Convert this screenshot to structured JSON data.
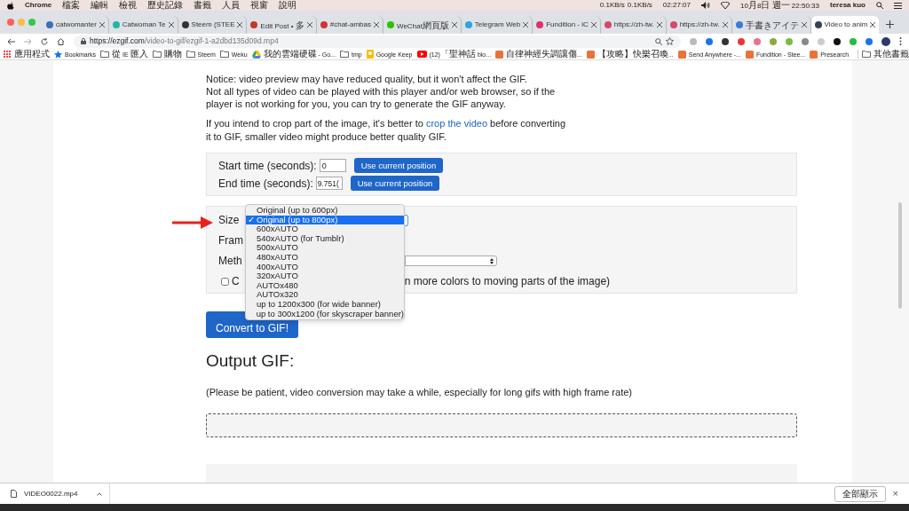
{
  "menubar": {
    "app": "Chrome",
    "items": [
      "檔案",
      "編輯",
      "檢視",
      "歷史記錄",
      "書籤",
      "人員",
      "視窗",
      "說明"
    ],
    "net_speed": [
      "0.1KB/s",
      "0.1KB/s"
    ],
    "timer": "02:27:07",
    "clock": "10月8日 週一 22:50:33",
    "user": "teresa kuo"
  },
  "tabs": [
    {
      "title": "catwomanter",
      "selected": false,
      "color": "#3b6fb6"
    },
    {
      "title": "Catwoman Te",
      "selected": false,
      "color": "#1fb8a8"
    },
    {
      "title": "Steem (STEE",
      "selected": false,
      "color": "#333333"
    },
    {
      "title": "Edit Post • 多",
      "selected": false,
      "color": "#c0392b"
    },
    {
      "title": "#chat-ambas",
      "selected": false,
      "color": "#d0343a"
    },
    {
      "title": "WeChat網頁版",
      "selected": false,
      "color": "#2dc100"
    },
    {
      "title": "Telegram Web",
      "selected": false,
      "color": "#2ca5e0"
    },
    {
      "title": "Fundition - iC",
      "selected": false,
      "color": "#e0306a"
    },
    {
      "title": "https://zh-tw.",
      "selected": false,
      "color": "#d04a6a"
    },
    {
      "title": "https://zh-tw.",
      "selected": false,
      "color": "#d04a6a"
    },
    {
      "title": "手書きアイテ",
      "selected": false,
      "color": "#3a7bd5"
    },
    {
      "title": "Video to anim",
      "selected": true,
      "color": "#334455"
    }
  ],
  "address": {
    "host": "https://ezgif.com",
    "path": "/video-to-gif/ezgif-1-a2dbd135d09d.mp4"
  },
  "bookmarks": [
    {
      "label": "應用程式",
      "kind": "apps"
    },
    {
      "label": "Bookmarks",
      "kind": "star"
    },
    {
      "label": "從 IE 匯入",
      "kind": "folder"
    },
    {
      "label": "購物",
      "kind": "folder"
    },
    {
      "label": "Steem",
      "kind": "folder"
    },
    {
      "label": "Weku",
      "kind": "folder"
    },
    {
      "label": "我的雲端硬碟 - Go...",
      "kind": "drive"
    },
    {
      "label": "tmp",
      "kind": "folder"
    },
    {
      "label": "Google Keep",
      "kind": "keep"
    },
    {
      "label": "(12)「聖神話 blo...",
      "kind": "video"
    },
    {
      "label": "自律神經失調讓傷...",
      "kind": "site"
    },
    {
      "label": "【攻略】快樂召喚...",
      "kind": "site"
    },
    {
      "label": "Send Anywhere -...",
      "kind": "site"
    },
    {
      "label": "Fundition - Stee...",
      "kind": "site"
    },
    {
      "label": "Presearch",
      "kind": "site"
    }
  ],
  "other_bookmarks": "其他書籤",
  "page": {
    "notice": "Notice: video preview may have reduced quality, but it won't affect the GIF.",
    "notice2": "Not all types of video can be played with this player and/or web browser, so if the player is not working for you, you can try to generate the GIF anyway.",
    "crop_before": "If you intend to crop part of the image, it's better to",
    "crop_link": "crop the video",
    "crop_after": "before converting it to GIF, smaller video might produce better quality GIF.",
    "start_label": "Start time (seconds):",
    "start_value": "0",
    "end_label": "End time (seconds):",
    "end_value": "9.751(",
    "position_button": "Use current position",
    "position_button2": "Use current position",
    "size_label": "Size",
    "frame_label": "Fram",
    "method_label": "Meth",
    "option_label_start": "C",
    "option_label_end": "n more colors to moving parts of the image)",
    "option_checked": false,
    "size_options": [
      {
        "label": "Original (up to 600px)",
        "selected": false
      },
      {
        "label": "Original (up to 800px)",
        "selected": true
      },
      {
        "label": "600xAUTO",
        "selected": false
      },
      {
        "label": "540xAUTO (for Tumblr)",
        "selected": false
      },
      {
        "label": "500xAUTO",
        "selected": false
      },
      {
        "label": "480xAUTO",
        "selected": false
      },
      {
        "label": "400xAUTO",
        "selected": false
      },
      {
        "label": "320xAUTO",
        "selected": false
      },
      {
        "label": "AUTOx480",
        "selected": false
      },
      {
        "label": "AUTOx320",
        "selected": false
      },
      {
        "label": "up to 1200x300 (for wide banner)",
        "selected": false
      },
      {
        "label": "up to 300x1200 (for skyscraper banner)",
        "selected": false
      }
    ],
    "check_mark": "✓",
    "convert_button": "Convert to GIF!",
    "output_title": "Output GIF:",
    "output_note": "(Please be patient, video conversion may take a while, especially for long gifs with high frame rate)"
  },
  "download": {
    "file": "VIDEO0022.mp4",
    "show_all": "全部顯示",
    "close": "×"
  }
}
